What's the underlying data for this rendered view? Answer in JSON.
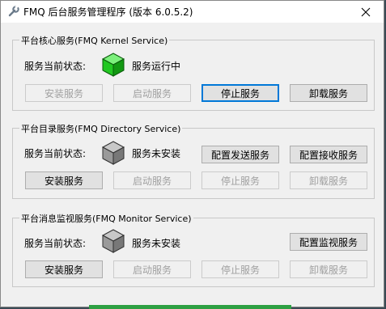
{
  "window": {
    "title": "FMQ 后台服务管理程序 (版本 6.0.5.2)"
  },
  "kernel": {
    "legend": "平台核心服务(FMQ Kernel Service)",
    "status_label": "服务当前状态:",
    "status_text": "服务运行中",
    "status_color": "#1ec81e",
    "buttons": {
      "install": "安装服务",
      "start": "启动服务",
      "stop": "停止服务",
      "uninstall": "卸载服务"
    }
  },
  "directory": {
    "legend": "平台目录服务(FMQ Directory Service)",
    "status_label": "服务当前状态:",
    "status_text": "服务未安装",
    "status_color": "#808080",
    "config_send": "配置发送服务",
    "config_recv": "配置接收服务",
    "buttons": {
      "install": "安装服务",
      "start": "启动服务",
      "stop": "停止服务",
      "uninstall": "卸载服务"
    }
  },
  "monitor": {
    "legend": "平台消息监视服务(FMQ Monitor Service)",
    "status_label": "服务当前状态:",
    "status_text": "服务未安装",
    "status_color": "#808080",
    "config_monitor": "配置监视服务",
    "buttons": {
      "install": "安装服务",
      "start": "启动服务",
      "stop": "停止服务",
      "uninstall": "卸载服务"
    }
  }
}
